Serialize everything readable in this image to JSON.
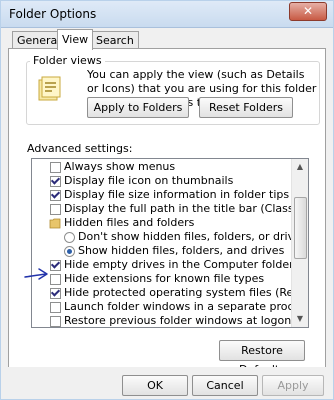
{
  "window": {
    "title": "Folder Options",
    "close_symbol": "✕"
  },
  "tabs": [
    {
      "label": "General"
    },
    {
      "label": "View"
    },
    {
      "label": "Search"
    }
  ],
  "folder_views": {
    "heading": "Folder views",
    "description": "You can apply the view (such as Details or Icons) that you are using for this folder to all folders of this type.",
    "apply_button": "Apply to Folders",
    "reset_button": "Reset Folders",
    "icon": "folder-view-icon"
  },
  "advanced": {
    "heading": "Advanced settings:",
    "items": [
      {
        "label": "Always show menus",
        "control": "checkbox",
        "checked": false
      },
      {
        "label": "Display file icon on thumbnails",
        "control": "checkbox",
        "checked": true
      },
      {
        "label": "Display file size information in folder tips",
        "control": "checkbox",
        "checked": true
      },
      {
        "label": "Display the full path in the title bar (Classic theme only)",
        "control": "checkbox",
        "checked": false
      },
      {
        "label": "Hidden files and folders",
        "control": "folder",
        "checked": null
      },
      {
        "label": "Don't show hidden files, folders, or drives",
        "control": "radio",
        "checked": false
      },
      {
        "label": "Show hidden files, folders, and drives",
        "control": "radio",
        "checked": true
      },
      {
        "label": "Hide empty drives in the Computer folder",
        "control": "checkbox",
        "checked": true
      },
      {
        "label": "Hide extensions for known file types",
        "control": "checkbox",
        "checked": false
      },
      {
        "label": "Hide protected operating system files (Recommended)",
        "control": "checkbox",
        "checked": true
      },
      {
        "label": "Launch folder windows in a separate process",
        "control": "checkbox",
        "checked": false
      },
      {
        "label": "Restore previous folder windows at logon",
        "control": "checkbox",
        "checked": false
      }
    ],
    "restore_button": "Restore Defaults"
  },
  "footer": {
    "ok_label": "OK",
    "cancel_label": "Cancel",
    "apply_label": "Apply"
  },
  "colors": {
    "annotation_arrow": "#2233aa"
  }
}
